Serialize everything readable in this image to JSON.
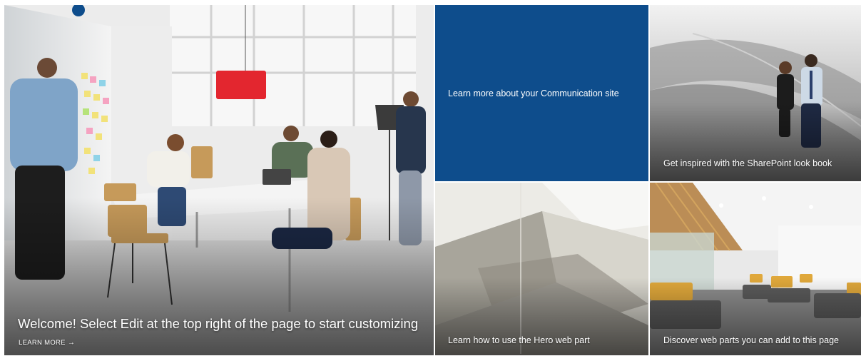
{
  "hero": {
    "main": {
      "title": "Welcome! Select Edit at the top right of the page to start customizing",
      "link_label": "LEARN MORE",
      "link_arrow": "→",
      "image": "office-meeting-photo"
    },
    "tiles": [
      {
        "title": "Learn more about your Communication site",
        "background": "#0e4d8c"
      },
      {
        "title": "Get inspired with the SharePoint look book",
        "image": "business-people-stairs-photo"
      },
      {
        "title": "Learn how to use the Hero web part",
        "image": "white-architecture-photo"
      },
      {
        "title": "Discover web parts you can add to this page",
        "image": "office-lounge-photo"
      }
    ]
  }
}
